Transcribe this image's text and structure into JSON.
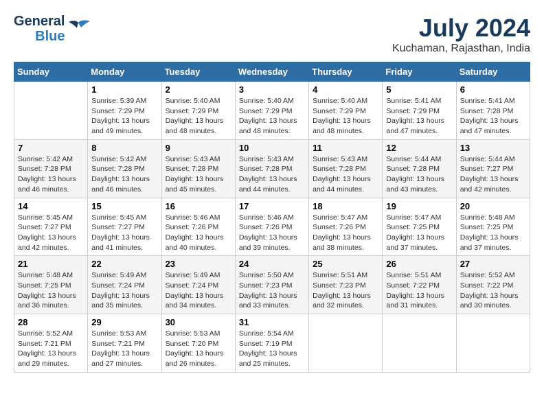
{
  "header": {
    "logo_line1": "General",
    "logo_line2": "Blue",
    "title": "July 2024",
    "subtitle": "Kuchaman, Rajasthan, India"
  },
  "weekdays": [
    "Sunday",
    "Monday",
    "Tuesday",
    "Wednesday",
    "Thursday",
    "Friday",
    "Saturday"
  ],
  "weeks": [
    [
      {
        "day": "",
        "info": ""
      },
      {
        "day": "1",
        "info": "Sunrise: 5:39 AM\nSunset: 7:29 PM\nDaylight: 13 hours\nand 49 minutes."
      },
      {
        "day": "2",
        "info": "Sunrise: 5:40 AM\nSunset: 7:29 PM\nDaylight: 13 hours\nand 48 minutes."
      },
      {
        "day": "3",
        "info": "Sunrise: 5:40 AM\nSunset: 7:29 PM\nDaylight: 13 hours\nand 48 minutes."
      },
      {
        "day": "4",
        "info": "Sunrise: 5:40 AM\nSunset: 7:29 PM\nDaylight: 13 hours\nand 48 minutes."
      },
      {
        "day": "5",
        "info": "Sunrise: 5:41 AM\nSunset: 7:29 PM\nDaylight: 13 hours\nand 47 minutes."
      },
      {
        "day": "6",
        "info": "Sunrise: 5:41 AM\nSunset: 7:28 PM\nDaylight: 13 hours\nand 47 minutes."
      }
    ],
    [
      {
        "day": "7",
        "info": "Sunrise: 5:42 AM\nSunset: 7:28 PM\nDaylight: 13 hours\nand 46 minutes."
      },
      {
        "day": "8",
        "info": "Sunrise: 5:42 AM\nSunset: 7:28 PM\nDaylight: 13 hours\nand 46 minutes."
      },
      {
        "day": "9",
        "info": "Sunrise: 5:43 AM\nSunset: 7:28 PM\nDaylight: 13 hours\nand 45 minutes."
      },
      {
        "day": "10",
        "info": "Sunrise: 5:43 AM\nSunset: 7:28 PM\nDaylight: 13 hours\nand 44 minutes."
      },
      {
        "day": "11",
        "info": "Sunrise: 5:43 AM\nSunset: 7:28 PM\nDaylight: 13 hours\nand 44 minutes."
      },
      {
        "day": "12",
        "info": "Sunrise: 5:44 AM\nSunset: 7:28 PM\nDaylight: 13 hours\nand 43 minutes."
      },
      {
        "day": "13",
        "info": "Sunrise: 5:44 AM\nSunset: 7:27 PM\nDaylight: 13 hours\nand 42 minutes."
      }
    ],
    [
      {
        "day": "14",
        "info": "Sunrise: 5:45 AM\nSunset: 7:27 PM\nDaylight: 13 hours\nand 42 minutes."
      },
      {
        "day": "15",
        "info": "Sunrise: 5:45 AM\nSunset: 7:27 PM\nDaylight: 13 hours\nand 41 minutes."
      },
      {
        "day": "16",
        "info": "Sunrise: 5:46 AM\nSunset: 7:26 PM\nDaylight: 13 hours\nand 40 minutes."
      },
      {
        "day": "17",
        "info": "Sunrise: 5:46 AM\nSunset: 7:26 PM\nDaylight: 13 hours\nand 39 minutes."
      },
      {
        "day": "18",
        "info": "Sunrise: 5:47 AM\nSunset: 7:26 PM\nDaylight: 13 hours\nand 38 minutes."
      },
      {
        "day": "19",
        "info": "Sunrise: 5:47 AM\nSunset: 7:25 PM\nDaylight: 13 hours\nand 37 minutes."
      },
      {
        "day": "20",
        "info": "Sunrise: 5:48 AM\nSunset: 7:25 PM\nDaylight: 13 hours\nand 37 minutes."
      }
    ],
    [
      {
        "day": "21",
        "info": "Sunrise: 5:48 AM\nSunset: 7:25 PM\nDaylight: 13 hours\nand 36 minutes."
      },
      {
        "day": "22",
        "info": "Sunrise: 5:49 AM\nSunset: 7:24 PM\nDaylight: 13 hours\nand 35 minutes."
      },
      {
        "day": "23",
        "info": "Sunrise: 5:49 AM\nSunset: 7:24 PM\nDaylight: 13 hours\nand 34 minutes."
      },
      {
        "day": "24",
        "info": "Sunrise: 5:50 AM\nSunset: 7:23 PM\nDaylight: 13 hours\nand 33 minutes."
      },
      {
        "day": "25",
        "info": "Sunrise: 5:51 AM\nSunset: 7:23 PM\nDaylight: 13 hours\nand 32 minutes."
      },
      {
        "day": "26",
        "info": "Sunrise: 5:51 AM\nSunset: 7:22 PM\nDaylight: 13 hours\nand 31 minutes."
      },
      {
        "day": "27",
        "info": "Sunrise: 5:52 AM\nSunset: 7:22 PM\nDaylight: 13 hours\nand 30 minutes."
      }
    ],
    [
      {
        "day": "28",
        "info": "Sunrise: 5:52 AM\nSunset: 7:21 PM\nDaylight: 13 hours\nand 29 minutes."
      },
      {
        "day": "29",
        "info": "Sunrise: 5:53 AM\nSunset: 7:21 PM\nDaylight: 13 hours\nand 27 minutes."
      },
      {
        "day": "30",
        "info": "Sunrise: 5:53 AM\nSunset: 7:20 PM\nDaylight: 13 hours\nand 26 minutes."
      },
      {
        "day": "31",
        "info": "Sunrise: 5:54 AM\nSunset: 7:19 PM\nDaylight: 13 hours\nand 25 minutes."
      },
      {
        "day": "",
        "info": ""
      },
      {
        "day": "",
        "info": ""
      },
      {
        "day": "",
        "info": ""
      }
    ]
  ]
}
